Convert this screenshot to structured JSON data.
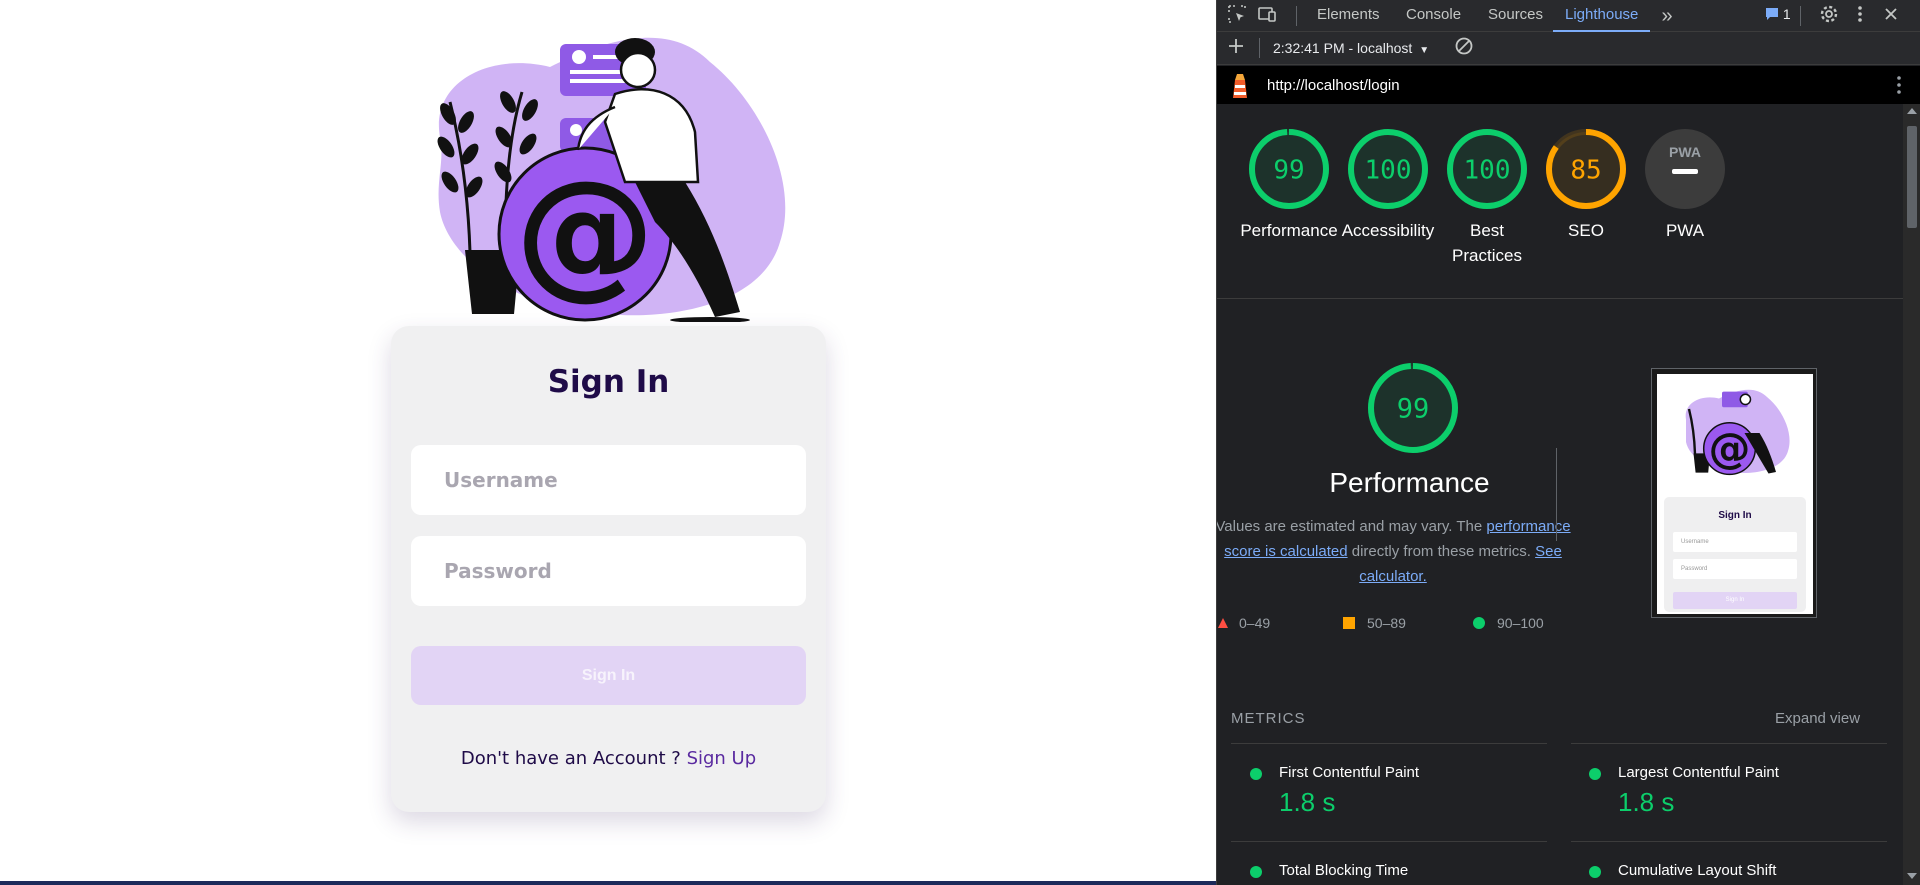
{
  "login": {
    "title": "Sign In",
    "username_placeholder": "Username",
    "password_placeholder": "Password",
    "signin_label": "Sign In",
    "signup_prompt": "Don't have an Account ? ",
    "signup_link": "Sign Up"
  },
  "devtools": {
    "tabs": [
      "Elements",
      "Console",
      "Sources",
      "Lighthouse"
    ],
    "active_tab": "Lighthouse",
    "more_tabs_glyph": "»",
    "issues_count": "1",
    "report_selector": "2:32:41 PM - localhost",
    "url": "http://localhost/login",
    "colors": {
      "pass": "#0cce6b",
      "average": "#ffa400",
      "fail": "#ff4e42",
      "link": "#7cacf8"
    },
    "scores": [
      {
        "label": "Performance",
        "value": 99,
        "rating": "pass"
      },
      {
        "label": "Accessibility",
        "value": 100,
        "rating": "pass"
      },
      {
        "label": "Best Practices",
        "value": 100,
        "rating": "pass"
      },
      {
        "label": "SEO",
        "value": 85,
        "rating": "average"
      },
      {
        "label": "PWA",
        "value": null,
        "rating": "na",
        "badge": "PWA"
      }
    ],
    "performance": {
      "score": 99,
      "title": "Performance",
      "desc_prefix": "Values are estimated and may vary. The ",
      "desc_link": "performance score is calculated",
      "desc_middle": " directly from these metrics. ",
      "desc_link2": "See calculator."
    },
    "legend": [
      "0–49",
      "50–89",
      "90–100"
    ],
    "thumbnail": {
      "title": "Sign In",
      "username": "Username",
      "password": "Password",
      "button": "Sign In"
    },
    "metrics_heading": "METRICS",
    "expand_label": "Expand view",
    "metrics": [
      {
        "label": "First Contentful Paint",
        "value": "1.8 s"
      },
      {
        "label": "Largest Contentful Paint",
        "value": "1.8 s"
      },
      {
        "label": "Total Blocking Time",
        "value": ""
      },
      {
        "label": "Cumulative Layout Shift",
        "value": ""
      }
    ]
  }
}
